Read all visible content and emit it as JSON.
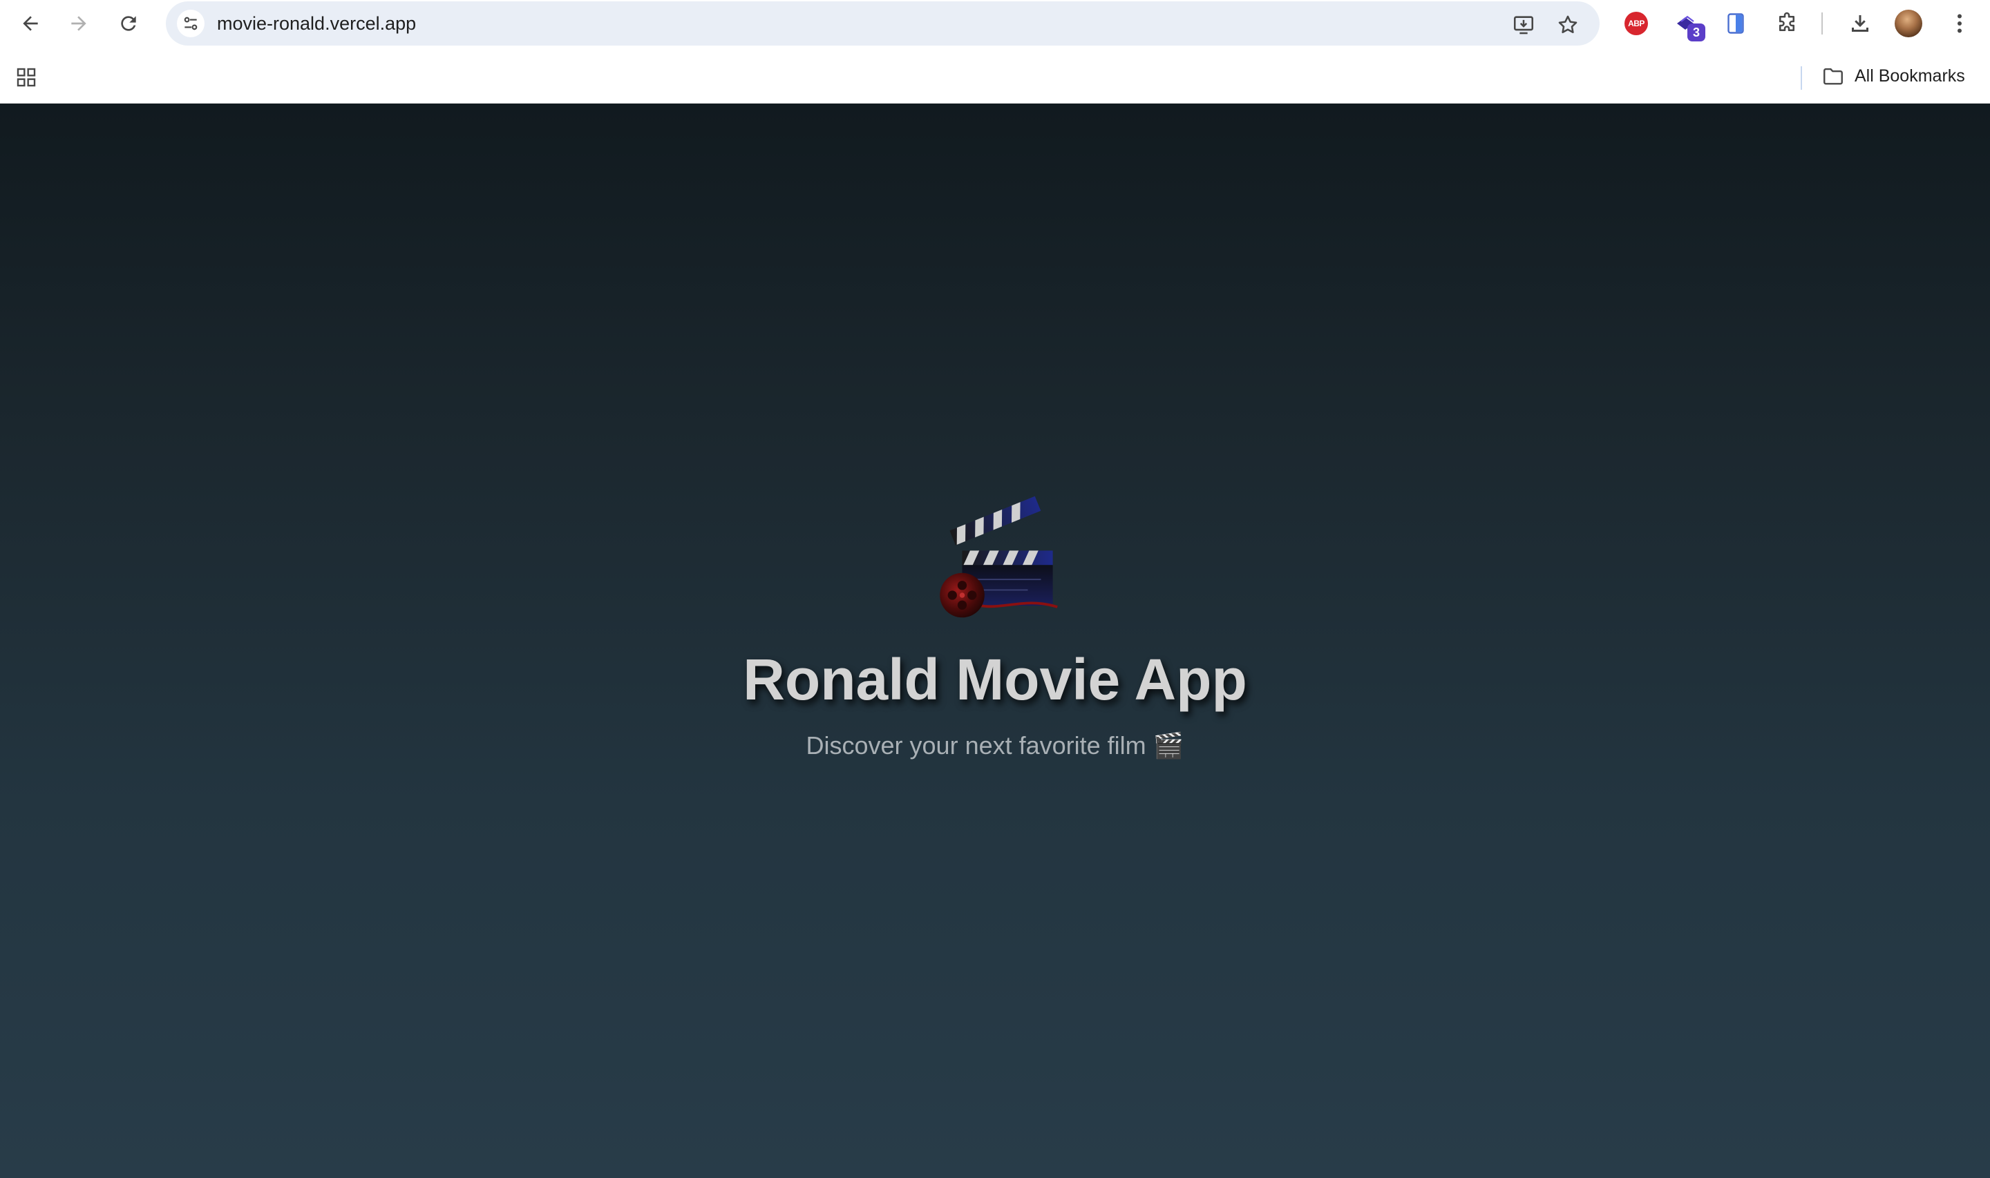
{
  "browser": {
    "url": "movie-ronald.vercel.app",
    "extension_badge": "3",
    "abp_label": "ABP",
    "bookmarks": {
      "all_bookmarks_label": "All Bookmarks"
    },
    "icons": [
      "back-icon",
      "forward-icon",
      "reload-icon",
      "site-info-icon",
      "install-app-icon",
      "bookmark-star-icon",
      "adblock-plus-icon",
      "extension-icon",
      "side-panel-icon",
      "extensions-puzzle-icon",
      "downloads-icon",
      "avatar",
      "menu-icon",
      "apps-grid-icon",
      "folder-icon"
    ]
  },
  "page": {
    "title": "Ronald Movie App",
    "subtitle": "Discover your next favorite film 🎬",
    "logo_icon": "clapperboard-film-reel-icon",
    "colors": {
      "background_top": "#111a1f",
      "background_bottom": "#283c49",
      "title": "#d3d3d3",
      "subtitle": "#a9b0b5"
    }
  }
}
